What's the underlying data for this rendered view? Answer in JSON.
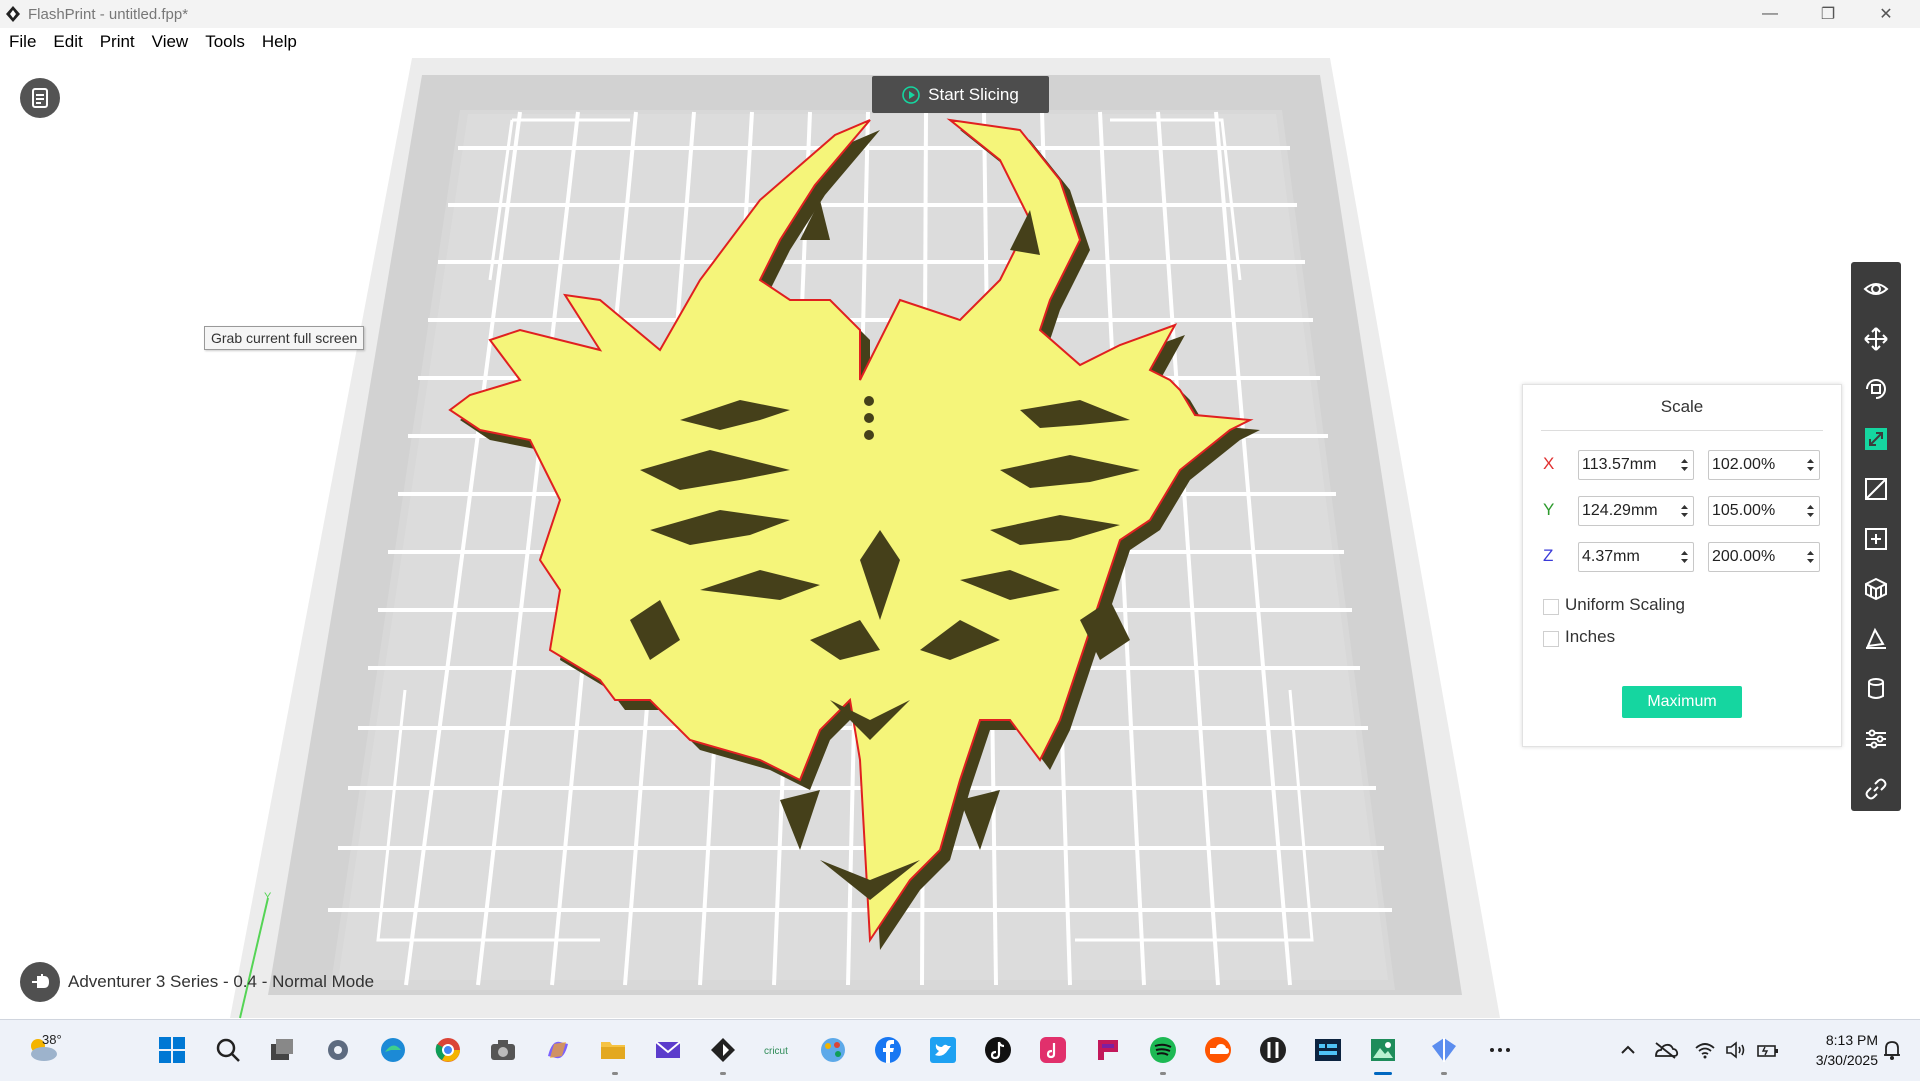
{
  "window": {
    "title": "FlashPrint - untitled.fpp*",
    "minimize": "—",
    "restore": "❐",
    "close": "✕"
  },
  "menu": [
    "File",
    "Edit",
    "Print",
    "View",
    "Tools",
    "Help"
  ],
  "toolbar_top": {
    "slice_label": "Start Slicing"
  },
  "tooltip": "Grab current full screen",
  "axis_indicator": "Y",
  "status": {
    "machine": "Adventurer 3 Series - 0.4 - Normal Mode"
  },
  "right_toolbar": [
    "eye-icon",
    "move-icon",
    "rotate-icon",
    "scale-icon",
    "cut-icon",
    "add-object-icon",
    "supports-icon",
    "lay-flat-icon",
    "cylinder-icon",
    "settings-sliders-icon",
    "link-icon"
  ],
  "scale_panel": {
    "title": "Scale",
    "x": {
      "label": "X",
      "size": "113.57mm",
      "percent": "102.00%",
      "color": "#e03030"
    },
    "y": {
      "label": "Y",
      "size": "124.29mm",
      "percent": "105.00%",
      "color": "#2d9a2d"
    },
    "z": {
      "label": "Z",
      "size": "4.37mm",
      "percent": "200.00%",
      "color": "#3a3ad8"
    },
    "uniform_label": "Uniform Scaling",
    "uniform_checked": false,
    "inches_label": "Inches",
    "inches_checked": false,
    "maximum_label": "Maximum",
    "accent": "#15d6a0"
  },
  "model": {
    "fill": "#f5f57a",
    "outline": "#e02020",
    "shade": "#45401a"
  },
  "taskbar": {
    "temperature": "38°",
    "time": "8:13 PM",
    "date": "3/30/2025",
    "apps": [
      "start-icon",
      "search-icon",
      "task-view-icon",
      "settings-icon",
      "edge-icon",
      "chrome-icon",
      "camera-icon",
      "copilot-icon",
      "file-explorer-icon",
      "mail-icon",
      "flashprint-icon",
      "cricut-icon",
      "paint-icon",
      "facebook-icon",
      "twitter-icon",
      "tiktok-icon",
      "app-icon",
      "pocketcasts-icon",
      "spotify-icon",
      "soundcloud-icon",
      "app-icon",
      "terminal-icon",
      "photos-icon",
      "sketch-icon",
      "more-icon"
    ],
    "tray": [
      "chevron-up-icon",
      "onedrive-icon",
      "wifi-icon",
      "volume-icon",
      "battery-icon",
      "notification-icon"
    ]
  }
}
